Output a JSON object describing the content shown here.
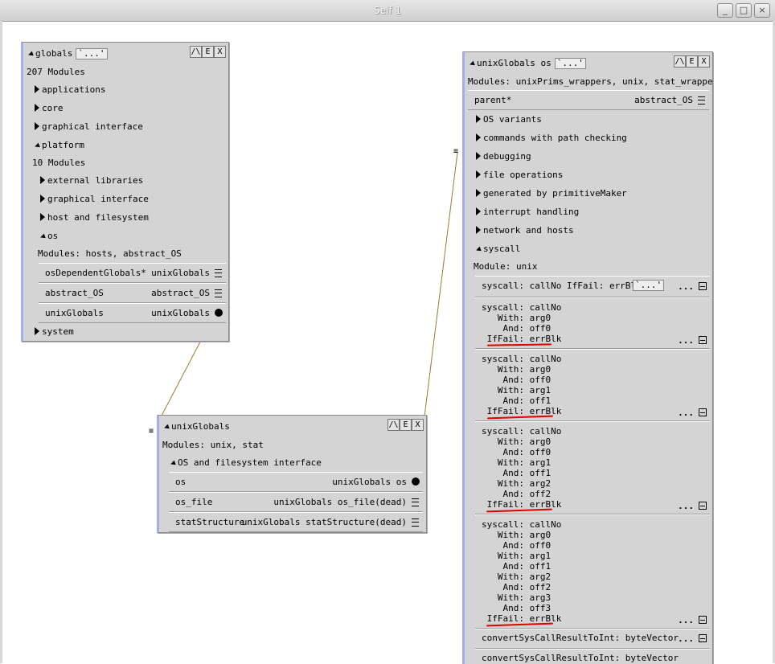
{
  "window": {
    "title": "Self 1"
  },
  "globals": {
    "name": "globals",
    "ellipsis": "`...'",
    "buttons": [
      "/\\",
      "E",
      "X"
    ],
    "count": "207 Modules",
    "items": [
      "applications",
      "core",
      "graphical interface",
      "platform"
    ],
    "platform_count": "10 Modules",
    "platform_items": [
      "external libraries",
      "graphical interface",
      "host and filesystem",
      "os"
    ],
    "os_modules": "Modules:  hosts, abstract_OS",
    "slots": [
      {
        "name": "osDependentGlobals*",
        "value": "unixGlobals"
      },
      {
        "name": "abstract_OS",
        "value": "abstract_OS"
      },
      {
        "name": "unixGlobals",
        "value": "unixGlobals"
      }
    ],
    "last": "system"
  },
  "unix_globals": {
    "name": "unixGlobals",
    "buttons": [
      "/\\",
      "E",
      "X"
    ],
    "modules": "Modules:  unix, stat",
    "category": "OS and filesystem interface",
    "slots": [
      {
        "name": "os",
        "value": "unixGlobals os"
      },
      {
        "name": "os_file",
        "value": "unixGlobals os_file(dead)"
      },
      {
        "name": "statStructure",
        "value": "unixGlobals statStructure(dead)"
      }
    ]
  },
  "unix_os": {
    "name": "unixGlobals os",
    "ellipsis": "`...'",
    "buttons": [
      "/\\",
      "E",
      "X"
    ],
    "modules": "Modules:  unixPrims_wrappers, unix, stat_wrappers",
    "parent": {
      "name": "parent*",
      "value": "abstract_OS"
    },
    "categories": [
      "OS variants",
      "commands with path checking",
      "debugging",
      "file operations",
      "generated by primitiveMaker",
      "interrupt handling",
      "network and hosts",
      "syscall"
    ],
    "syscall_module": "Module: unix",
    "first_method": "syscall: callNo IfFail: errBlk",
    "methods": [
      [
        "syscall: callNo",
        "   With: arg0",
        "    And: off0",
        " IfFail: errBlk"
      ],
      [
        "syscall: callNo",
        "   With: arg0",
        "    And: off0",
        "   With: arg1",
        "    And: off1",
        " IfFail: errBlk"
      ],
      [
        "syscall: callNo",
        "   With: arg0",
        "    And: off0",
        "   With: arg1",
        "    And: off1",
        "   With: arg2",
        "    And: off2",
        " IfFail: errBlk"
      ],
      [
        "syscall: callNo",
        "   With: arg0",
        "    And: off0",
        "   With: arg1",
        "    And: off1",
        "   With: arg2",
        "    And: off2",
        "   With: arg3",
        "    And: off3",
        " IfFail: errBlk"
      ]
    ],
    "convert1": "convertSysCallResultToInt: byteVector",
    "convert2": "convertSysCallResultToInt: byteVector",
    "dots": "..."
  },
  "colors": {
    "accent_border": "#a9abf0",
    "annotation": "#e00000",
    "link": "#a07830"
  }
}
